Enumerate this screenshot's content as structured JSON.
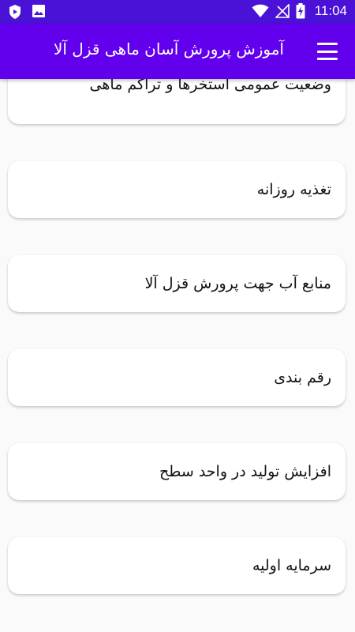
{
  "status_bar": {
    "time": "11:04",
    "icons": [
      "play-protect-icon",
      "image-icon",
      "wifi-icon",
      "no-signal-icon",
      "battery-charging-icon"
    ]
  },
  "app_bar": {
    "title": "آموزش پرورش آسان ماهی قزل آلا",
    "menu_icon": "hamburger-menu-icon"
  },
  "items": [
    {
      "label": "وضعیت عمومی استخرها و تراکم ماهی"
    },
    {
      "label": "تغذیه روزانه"
    },
    {
      "label": "منابع آب جهت پرورش قزل آلا"
    },
    {
      "label": "رقم بندی"
    },
    {
      "label": "افزایش تولید در واحد سطح"
    },
    {
      "label": "سرمایه اولیه"
    }
  ],
  "colors": {
    "status_bar": "#4a12d6",
    "app_bar": "#6200ee",
    "background": "#fafafa",
    "card": "#ffffff"
  }
}
